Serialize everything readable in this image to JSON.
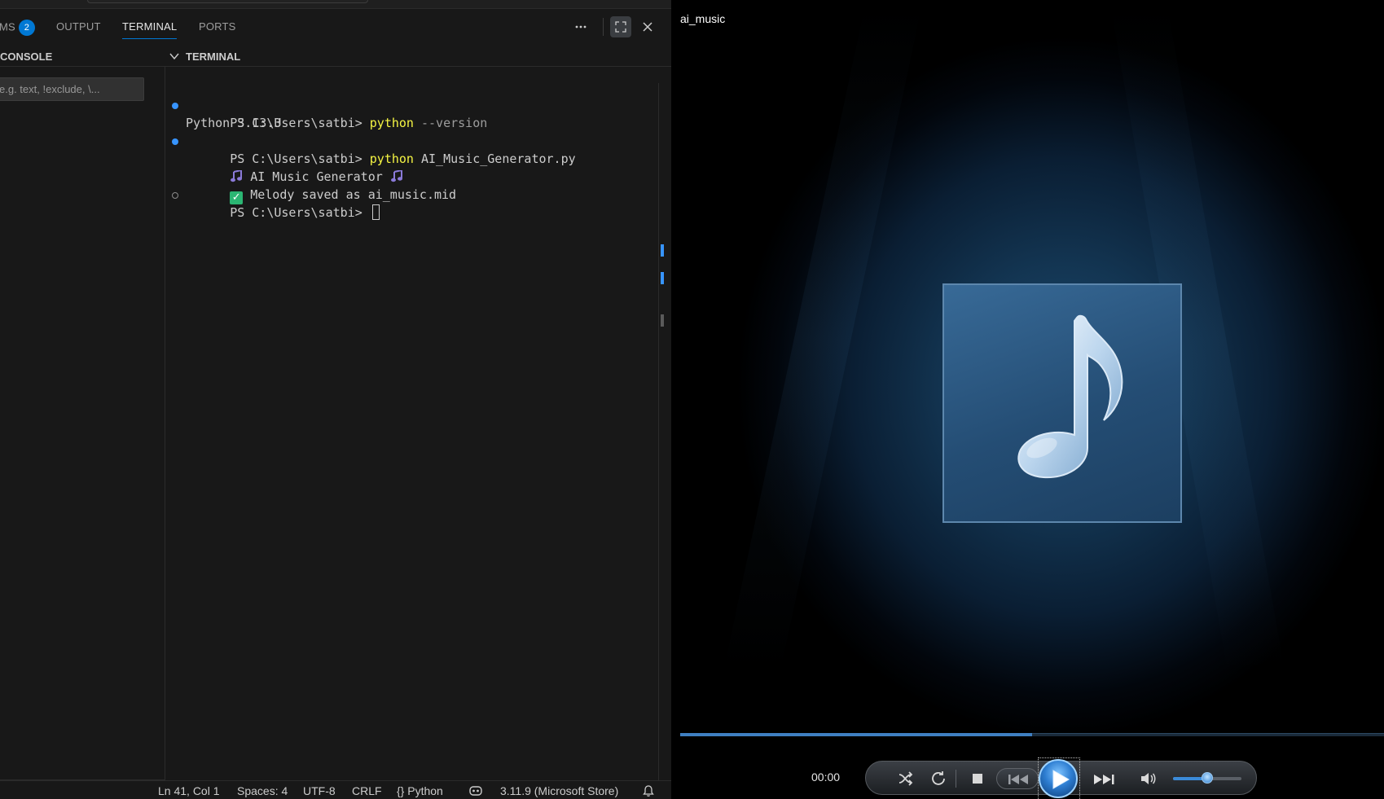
{
  "vscode": {
    "tabs": [
      {
        "label": "MS",
        "badge": "2"
      },
      {
        "label": "OUTPUT"
      },
      {
        "label": "TERMINAL"
      },
      {
        "label": "PORTS"
      }
    ],
    "active_tab": "TERMINAL",
    "actions": {
      "more_icon": "ellipsis-icon",
      "maximize_icon": "maximize-panel-icon",
      "close_icon": "close-icon"
    },
    "sections": {
      "left_title": "CONSOLE",
      "right_title": "TERMINAL"
    },
    "filter": {
      "placeholder": "e.g. text, !exclude, \\..."
    },
    "terminal": {
      "lines": [
        {
          "prompt": "PS C:\\Users\\satbi> ",
          "cmd": "python",
          "arg": " --version"
        },
        {
          "text": "Python 3.13.3"
        },
        {
          "prompt": "PS C:\\Users\\satbi> ",
          "cmd": "python",
          "arg": " AI_Music_Generator.py"
        },
        {
          "text": " AI Music Generator "
        },
        {
          "text": " Melody saved as ai_music.mid"
        },
        {
          "prompt": "PS C:\\Users\\satbi> "
        }
      ]
    },
    "statusbar": {
      "position": "Ln 41, Col 1",
      "spaces": "Spaces: 4",
      "encoding": "UTF-8",
      "eol": "CRLF",
      "language": "{} Python",
      "copilot_icon": "copilot-icon",
      "interpreter": "3.11.9 (Microsoft Store)",
      "bell_icon": "bell-icon"
    },
    "colors": {
      "accent": "#0078d4",
      "prompt_dot": "#3794ff",
      "command": "#f5f543",
      "bg": "#181818"
    }
  },
  "player": {
    "title": "ai_music",
    "time": "00:00",
    "progress": 0.5,
    "volume": 0.5,
    "icons": {
      "art": "music-note-icon",
      "shuffle": "shuffle-icon",
      "repeat": "repeat-icon",
      "stop": "stop-icon",
      "previous": "previous-icon",
      "play": "play-icon",
      "next": "next-icon",
      "volume": "volume-icon"
    },
    "colors": {
      "accent": "#3f7fc1",
      "bg_glow": "#1d4a70"
    }
  }
}
